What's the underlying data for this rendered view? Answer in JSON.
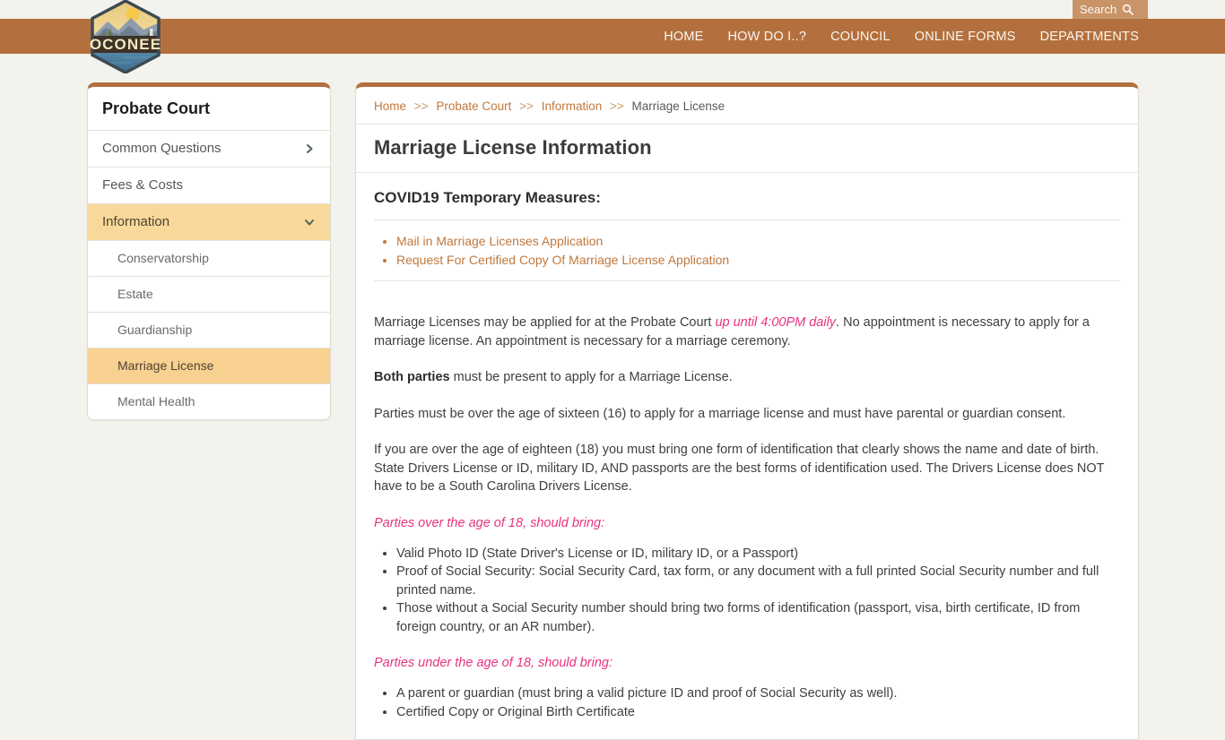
{
  "site": {
    "logo_text": "OCONEE",
    "logo_icon": "oconee-hexagon-badge-logo"
  },
  "search": {
    "label": "Search",
    "icon": "search-icon"
  },
  "nav": {
    "items": [
      {
        "label": "HOME"
      },
      {
        "label": "HOW DO I..?"
      },
      {
        "label": "COUNCIL"
      },
      {
        "label": "ONLINE FORMS"
      },
      {
        "label": "DEPARTMENTS"
      }
    ]
  },
  "sidebar": {
    "title": "Probate Court",
    "items": [
      {
        "label": "Common Questions",
        "icon": "chevron-right-icon",
        "active": false,
        "sub": false
      },
      {
        "label": "Fees & Costs",
        "icon": "",
        "active": false,
        "sub": false
      },
      {
        "label": "Information",
        "icon": "chevron-down-icon",
        "active": true,
        "sub": false
      },
      {
        "label": "Conservatorship",
        "icon": "",
        "active": false,
        "sub": true
      },
      {
        "label": "Estate",
        "icon": "",
        "active": false,
        "sub": true
      },
      {
        "label": "Guardianship",
        "icon": "",
        "active": false,
        "sub": true
      },
      {
        "label": "Marriage License",
        "icon": "",
        "active": true,
        "sub": true
      },
      {
        "label": "Mental Health",
        "icon": "",
        "active": false,
        "sub": true
      }
    ]
  },
  "breadcrumb": {
    "separator": ">>",
    "items": [
      {
        "label": "Home",
        "current": false
      },
      {
        "label": "Probate Court",
        "current": false
      },
      {
        "label": "Information",
        "current": false
      },
      {
        "label": "Marriage License",
        "current": true
      }
    ]
  },
  "main": {
    "title": "Marriage License Information",
    "covid_heading": "COVID19 Temporary Measures:",
    "covid_links": [
      {
        "label": "Mail in Marriage Licenses Application"
      },
      {
        "label": "Request For Certified Copy Of Marriage License Application"
      }
    ],
    "para1_a": "Marriage Licenses may be applied for at the Probate Court ",
    "para1_em": "up until 4:00PM daily",
    "para1_b": ". No appointment is necessary to apply for a marriage license. An appointment is necessary for a marriage ceremony.",
    "para2_strong": "Both parties",
    "para2_rest": " must be present to apply for a Marriage License.",
    "para3": "Parties must be over the age of sixteen (16) to apply for a marriage license and must have parental or guardian consent.",
    "para4": "If you are over the age of eighteen (18) you must bring one form of identification that clearly shows the name and date of birth. State Drivers License or ID, military ID, AND passports are the best forms of identification used. The Drivers License does NOT have to be a South Carolina Drivers License.",
    "over18_heading": "Parties over the age of 18, should bring:",
    "over18_items": [
      "Valid Photo ID (State Driver's License or ID, military ID, or a Passport)",
      "Proof of Social Security: Social Security Card, tax form, or any document with a full printed Social Security number and full printed name.",
      "Those without a Social Security number should bring two forms of identification (passport, visa, birth certificate, ID from foreign country, or an AR number)."
    ],
    "under18_heading": "Parties under the age of 18, should bring:",
    "under18_items": [
      "A parent or guardian (must bring a valid picture ID and proof of Social Security as well).",
      "Certified Copy or Original Birth Certificate"
    ]
  },
  "colors": {
    "brand_brown": "#b3703e",
    "search_bg": "#c89468",
    "page_bg": "#f4f2ec",
    "accent_link": "#c0783d",
    "highlight_yellow": "#f8d08f",
    "pink": "#e8337f"
  }
}
